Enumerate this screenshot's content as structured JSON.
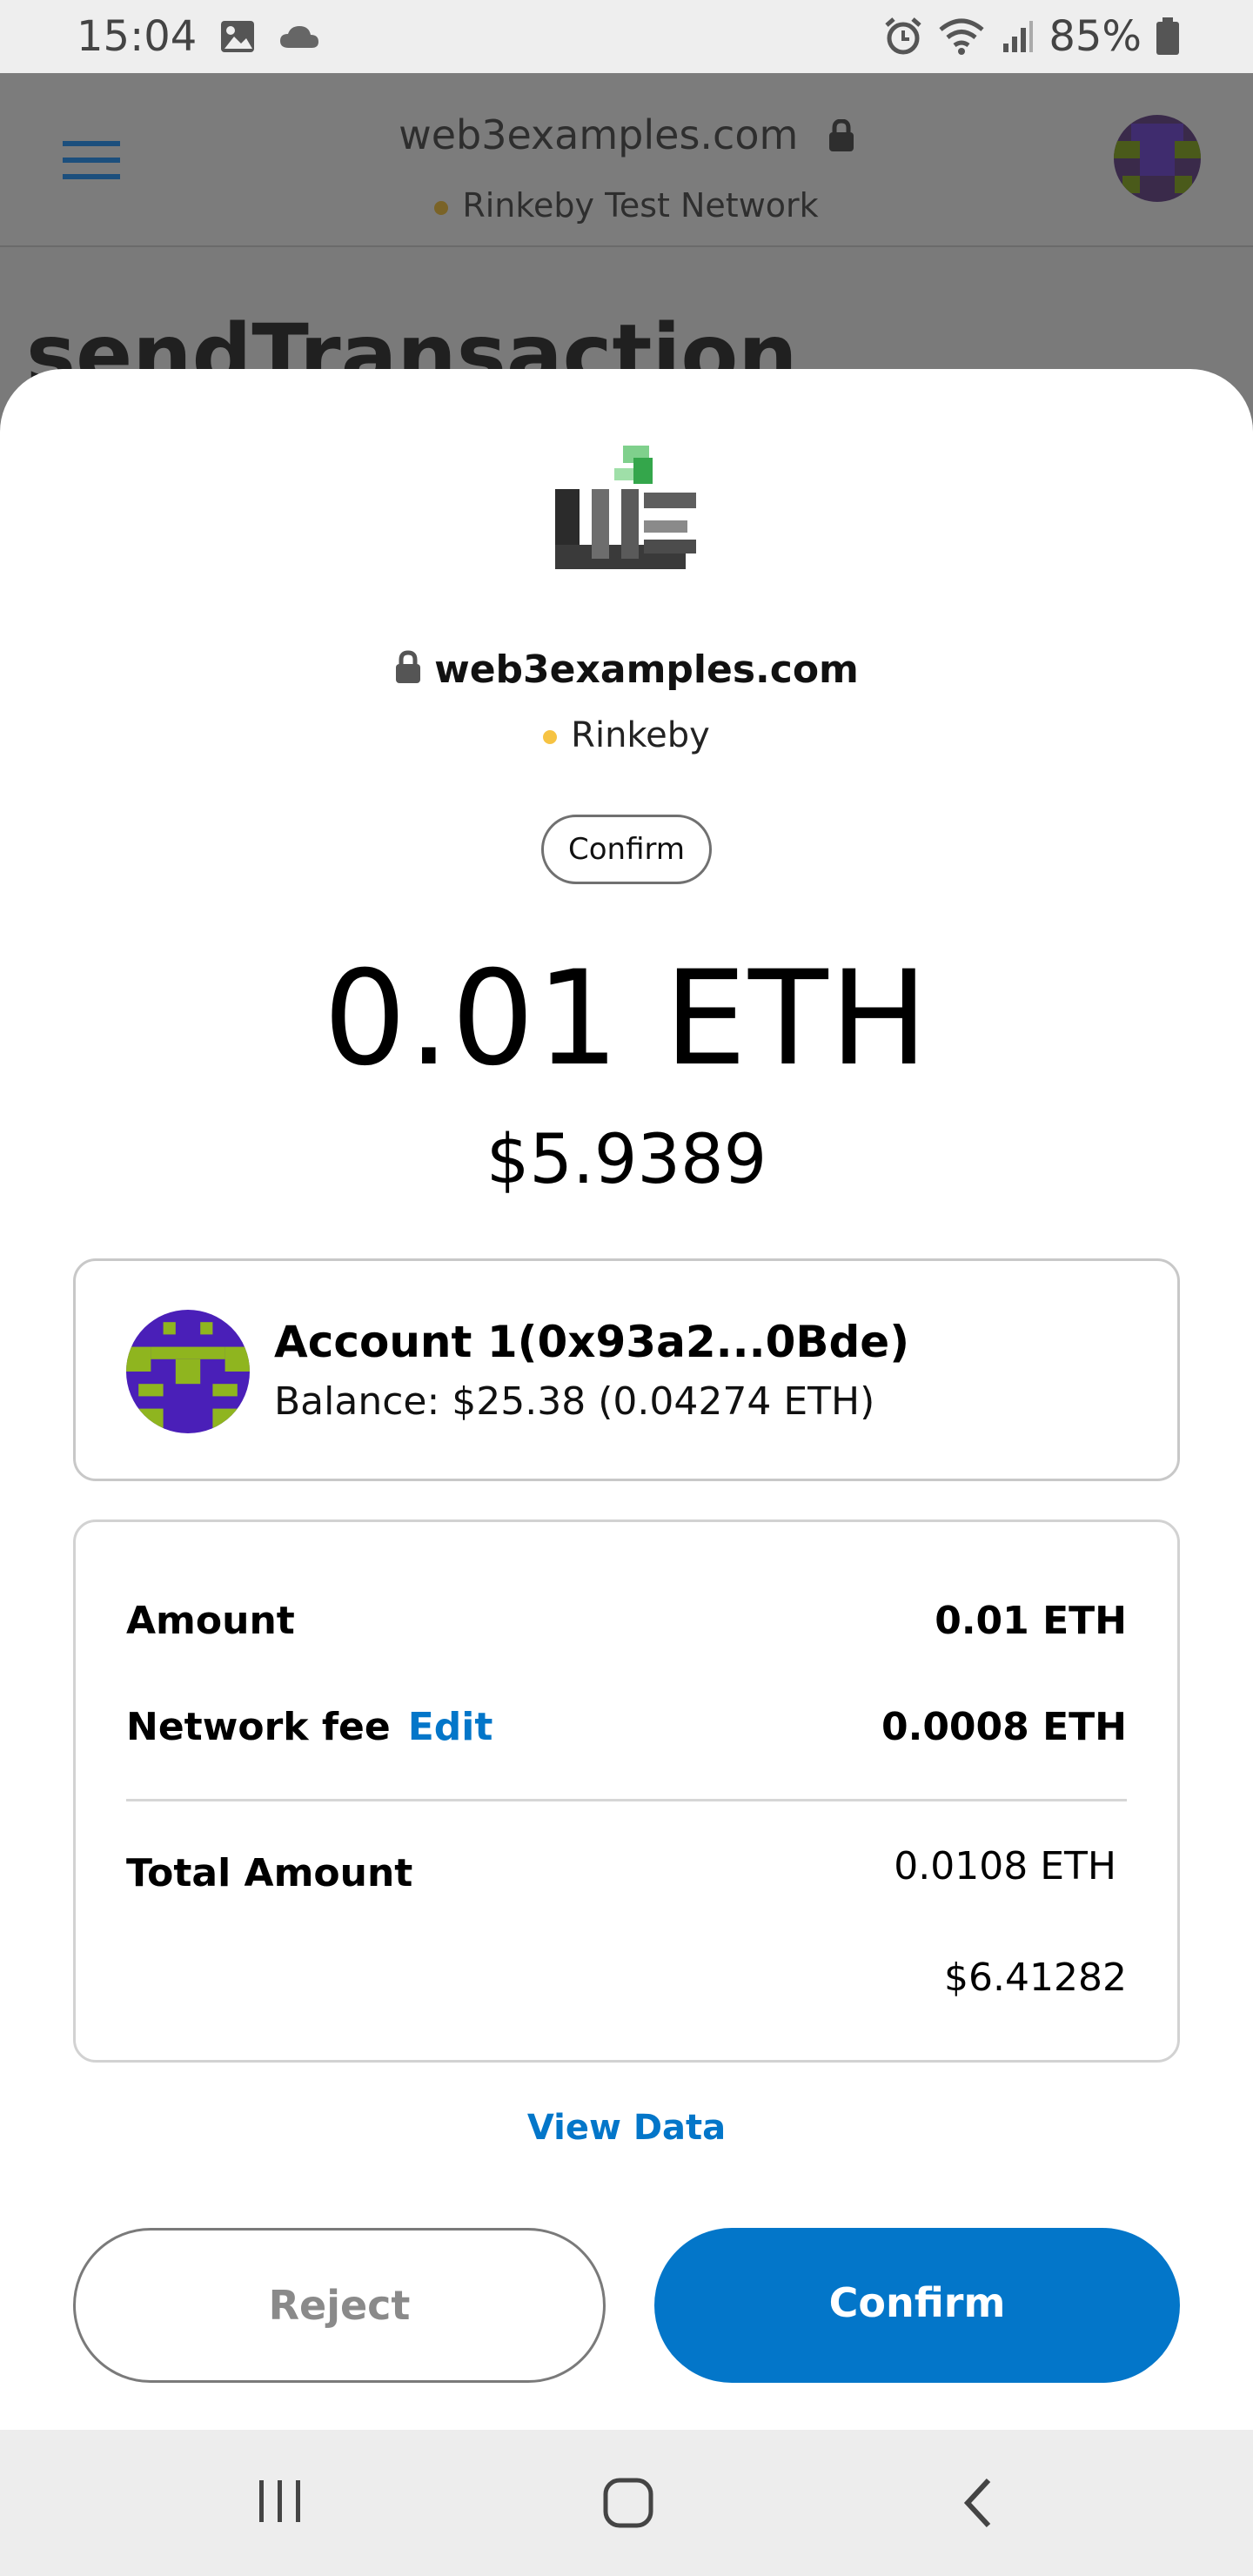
{
  "status_bar": {
    "time": "15:04",
    "battery": "85%",
    "icons": [
      "image-icon",
      "cloud-icon",
      "alarm-icon",
      "wifi-icon",
      "signal-icon",
      "battery-icon"
    ]
  },
  "browser_header": {
    "url": "web3examples.com",
    "network": "Rinkeby Test Network",
    "page_title": "sendTransaction"
  },
  "sheet": {
    "site": "web3examples.com",
    "chain": "Rinkeby",
    "pill_label": "Confirm",
    "amount": "0.01 ETH",
    "amount_fiat": "$5.9389"
  },
  "account": {
    "name": "Account 1(0x93a2...0Bde)",
    "balance": "Balance: $25.38 (0.04274 ETH)"
  },
  "summary": {
    "amount_label": "Amount",
    "amount_value": "0.01 ETH",
    "fee_label": "Network fee",
    "fee_edit": "Edit",
    "fee_value": "0.0008 ETH",
    "total_label": "Total Amount",
    "total_eth": "0.0108 ETH",
    "total_fiat": "$6.41282"
  },
  "actions": {
    "view_data": "View Data",
    "reject": "Reject",
    "confirm": "Confirm"
  },
  "colors": {
    "primary": "#0376c9",
    "network_dot": "#f6c343",
    "avatar_purple": "#4a1fb8",
    "avatar_green": "#8fb51f"
  }
}
